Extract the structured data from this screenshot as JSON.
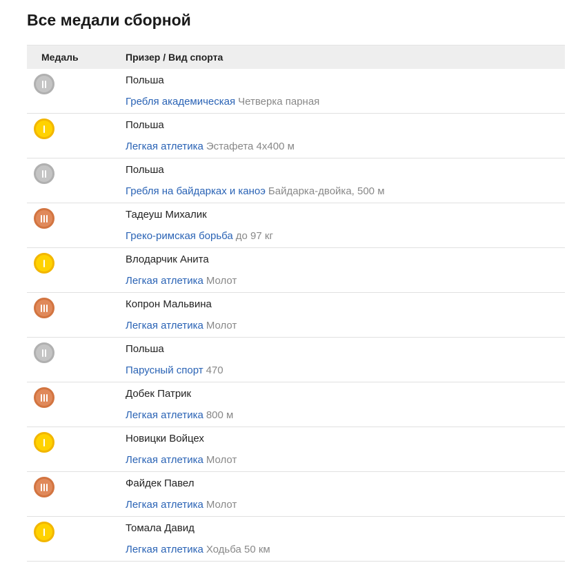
{
  "title": "Все медали сборной",
  "table": {
    "col_medal": "Медаль",
    "col_winner": "Призер / Вид спорта"
  },
  "colors": {
    "gold": "#ffd200",
    "silver": "#c4c4c4",
    "bronze": "#e0895a",
    "link": "#2a63b5",
    "muted": "#888888"
  },
  "rows": [
    {
      "medal": "silver",
      "medal_icon": "silver-medal-icon",
      "winner": "Польша",
      "sport": "Гребля академическая",
      "event": "Четверка парная"
    },
    {
      "medal": "gold",
      "medal_icon": "gold-medal-icon",
      "winner": "Польша",
      "sport": "Легкая атлетика",
      "event": "Эстафета 4х400 м"
    },
    {
      "medal": "silver",
      "medal_icon": "silver-medal-icon",
      "winner": "Польша",
      "sport": "Гребля на байдарках и каноэ",
      "event": "Байдарка-двойка, 500 м"
    },
    {
      "medal": "bronze",
      "medal_icon": "bronze-medal-icon",
      "winner": "Тадеуш Михалик",
      "sport": "Греко-римская борьба",
      "event": "до 97 кг"
    },
    {
      "medal": "gold",
      "medal_icon": "gold-medal-icon",
      "winner": "Влодарчик Анита",
      "sport": "Легкая атлетика",
      "event": "Молот"
    },
    {
      "medal": "bronze",
      "medal_icon": "bronze-medal-icon",
      "winner": "Копрон Мальвина",
      "sport": "Легкая атлетика",
      "event": "Молот"
    },
    {
      "medal": "silver",
      "medal_icon": "silver-medal-icon",
      "winner": "Польша",
      "sport": "Парусный спорт",
      "event": "470"
    },
    {
      "medal": "bronze",
      "medal_icon": "bronze-medal-icon",
      "winner": "Добек Патрик",
      "sport": "Легкая атлетика",
      "event": "800 м"
    },
    {
      "medal": "gold",
      "medal_icon": "gold-medal-icon",
      "winner": "Новицки Войцех",
      "sport": "Легкая атлетика",
      "event": "Молот"
    },
    {
      "medal": "bronze",
      "medal_icon": "bronze-medal-icon",
      "winner": "Файдек Павел",
      "sport": "Легкая атлетика",
      "event": "Молот"
    },
    {
      "medal": "gold",
      "medal_icon": "gold-medal-icon",
      "winner": "Томала Давид",
      "sport": "Легкая атлетика",
      "event": "Ходьба 50 км"
    }
  ]
}
